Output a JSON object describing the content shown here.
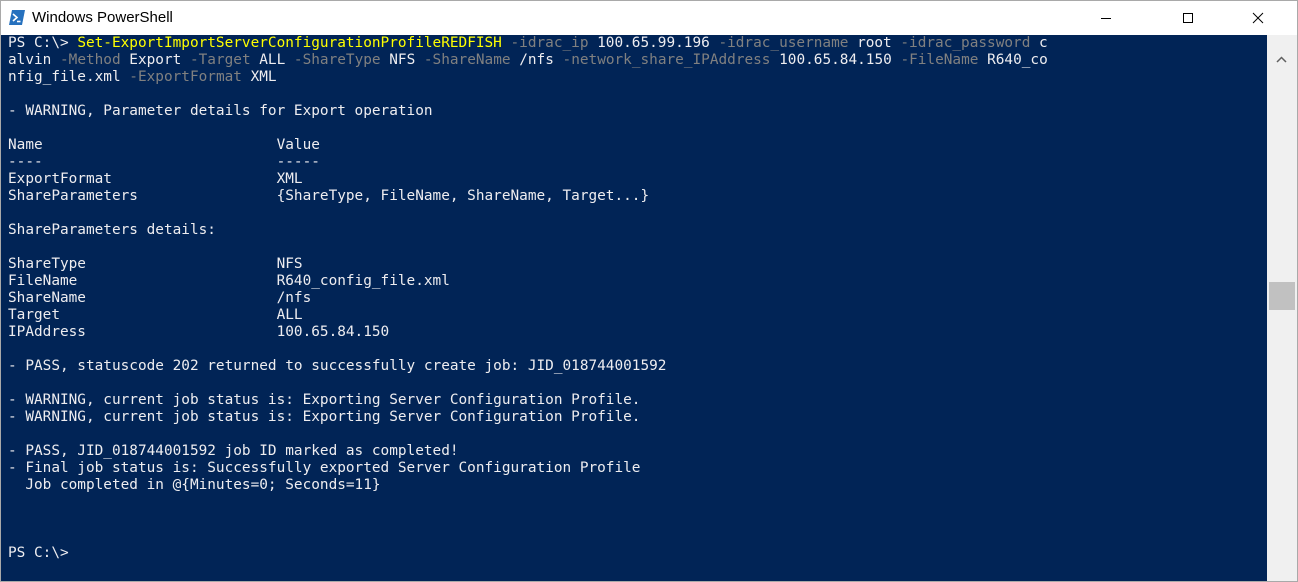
{
  "window": {
    "title": "Windows PowerShell",
    "icon": "powershell-icon",
    "controls": [
      "minimize-icon",
      "maximize-icon",
      "close-icon"
    ]
  },
  "colors": {
    "console_bg": "#012456",
    "console_fg": "#eeedf0",
    "command": "#ffff00",
    "parameter": "#808080"
  },
  "console": {
    "line1": {
      "prompt": "PS C:\\> ",
      "cmdlet": "Set-ExportImportServerConfigurationProfileREDFISH",
      "p1": " -idrac_ip",
      "v1": " 100.65.99.196",
      "p2": " -idrac_username",
      "v2": " root",
      "p3": " -idrac_password",
      "v3": " c"
    },
    "line2": {
      "v0": "alvin",
      "p1": " -Method",
      "v1": " Export",
      "p2": " -Target",
      "v2": " ALL",
      "p3": " -ShareType",
      "v3": " NFS",
      "p4": " -ShareName",
      "v4": " /nfs",
      "p5": " -network_share_IPAddress",
      "v5": " 100.65.84.150",
      "p6": " -FileName",
      "v6": " R640_co"
    },
    "line3": {
      "v0": "nfig_file.xml",
      "p1": " -ExportFormat",
      "v1": " XML"
    },
    "output": [
      "",
      "- WARNING, Parameter details for Export operation",
      "",
      "Name                           Value",
      "----                           -----",
      "ExportFormat                   XML",
      "ShareParameters                {ShareType, FileName, ShareName, Target...}",
      "",
      "ShareParameters details:",
      "",
      "ShareType                      NFS",
      "FileName                       R640_config_file.xml",
      "ShareName                      /nfs",
      "Target                         ALL",
      "IPAddress                      100.65.84.150",
      "",
      "- PASS, statuscode 202 returned to successfully create job: JID_018744001592",
      "",
      "- WARNING, current job status is: Exporting Server Configuration Profile.",
      "- WARNING, current job status is: Exporting Server Configuration Profile.",
      "",
      "- PASS, JID_018744001592 job ID marked as completed!",
      "- Final job status is: Successfully exported Server Configuration Profile",
      "  Job completed in @{Minutes=0; Seconds=11}",
      "",
      "",
      "",
      "PS C:\\>"
    ]
  }
}
